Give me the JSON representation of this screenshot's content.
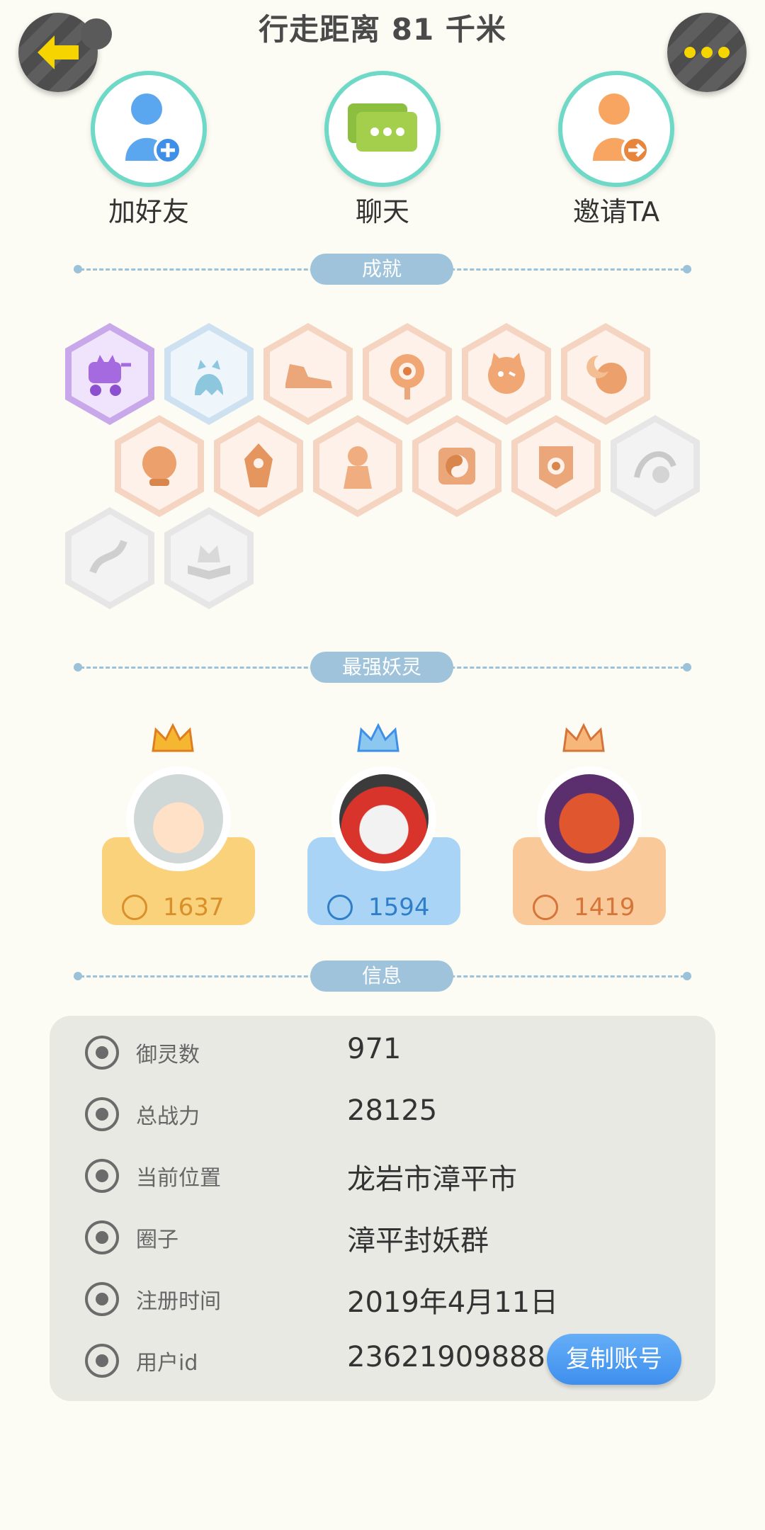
{
  "header": {
    "title": "行走距离 81 千米",
    "back_icon": "back-arrow-icon",
    "more_icon": "more-dots-icon"
  },
  "actions": [
    {
      "label": "加好友",
      "icon": "add-friend-icon"
    },
    {
      "label": "聊天",
      "icon": "chat-icon"
    },
    {
      "label": "邀请TA",
      "icon": "invite-icon"
    }
  ],
  "sections": {
    "achievements": "成就",
    "strongest": "最强妖灵",
    "info": "信息"
  },
  "achievements": [
    {
      "icon": "cat-stroller-badge-icon",
      "state": "purple"
    },
    {
      "icon": "ghost-cat-badge-icon",
      "state": "blue"
    },
    {
      "icon": "sneaker-badge-icon",
      "state": "earned"
    },
    {
      "icon": "compass-badge-icon",
      "state": "earned"
    },
    {
      "icon": "fox-mask-badge-icon",
      "state": "earned"
    },
    {
      "icon": "moon-badge-icon",
      "state": "earned"
    },
    {
      "icon": "crystal-ball-badge-icon",
      "state": "earned"
    },
    {
      "icon": "gem-badge-icon",
      "state": "earned"
    },
    {
      "icon": "doll-badge-icon",
      "state": "earned"
    },
    {
      "icon": "taiji-badge-icon",
      "state": "earned"
    },
    {
      "icon": "scroll-badge-icon",
      "state": "earned"
    },
    {
      "icon": "wave-taiji-badge-icon",
      "state": "locked"
    },
    {
      "icon": "dragon-badge-icon",
      "state": "locked"
    },
    {
      "icon": "fox-book-badge-icon",
      "state": "locked"
    }
  ],
  "spirits": [
    {
      "power": "1637",
      "crown": "gold-crown-icon",
      "color": "#f9d27b",
      "text_color": "#d9902a"
    },
    {
      "power": "1594",
      "crown": "blue-crown-icon",
      "color": "#a9d4f5",
      "text_color": "#2f7fc8"
    },
    {
      "power": "1419",
      "crown": "orange-crown-icon",
      "color": "#f9c99a",
      "text_color": "#d6753a"
    }
  ],
  "info": {
    "rows": [
      {
        "key": "御灵数",
        "value": "971",
        "icon": "spirit-count-icon"
      },
      {
        "key": "总战力",
        "value": "28125",
        "icon": "sword-icon"
      },
      {
        "key": "当前位置",
        "value": "龙岩市漳平市",
        "icon": "location-pin-icon"
      },
      {
        "key": "圈子",
        "value": "漳平封妖群",
        "icon": "circle-group-icon"
      },
      {
        "key": "注册时间",
        "value": "2019年4月11日",
        "icon": "clock-icon"
      },
      {
        "key": "用户id",
        "value": "23621909888",
        "icon": "id-card-icon"
      }
    ],
    "copy_label": "复制账号"
  },
  "colors": {
    "accent_blue": "#4a9af2",
    "divider": "#9ec3db",
    "back_arrow": "#f5d400"
  }
}
